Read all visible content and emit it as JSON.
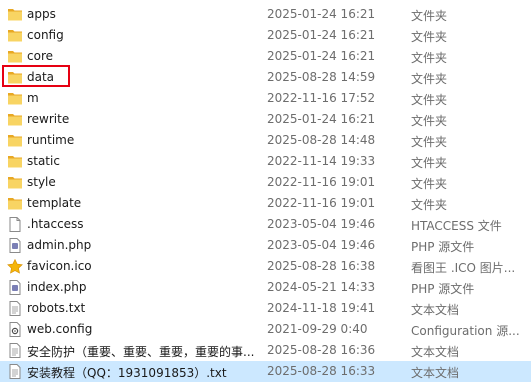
{
  "files": [
    {
      "name": "apps",
      "date": "2025-01-24 16:21",
      "type": "文件夹",
      "icon": "folder-icon"
    },
    {
      "name": "config",
      "date": "2025-01-24 16:21",
      "type": "文件夹",
      "icon": "folder-icon"
    },
    {
      "name": "core",
      "date": "2025-01-24 16:21",
      "type": "文件夹",
      "icon": "folder-icon"
    },
    {
      "name": "data",
      "date": "2025-08-28 14:59",
      "type": "文件夹",
      "icon": "folder-icon"
    },
    {
      "name": "m",
      "date": "2022-11-16 17:52",
      "type": "文件夹",
      "icon": "folder-icon"
    },
    {
      "name": "rewrite",
      "date": "2025-01-24 16:21",
      "type": "文件夹",
      "icon": "folder-icon"
    },
    {
      "name": "runtime",
      "date": "2025-08-28 14:48",
      "type": "文件夹",
      "icon": "folder-icon"
    },
    {
      "name": "static",
      "date": "2022-11-14 19:33",
      "type": "文件夹",
      "icon": "folder-icon"
    },
    {
      "name": "style",
      "date": "2022-11-16 19:01",
      "type": "文件夹",
      "icon": "folder-icon"
    },
    {
      "name": "template",
      "date": "2022-11-16 19:01",
      "type": "文件夹",
      "icon": "folder-icon"
    },
    {
      "name": ".htaccess",
      "date": "2023-05-04 19:46",
      "type": "HTACCESS 文件",
      "icon": "file-icon"
    },
    {
      "name": "admin.php",
      "date": "2023-05-04 19:46",
      "type": "PHP 源文件",
      "icon": "php-file-icon"
    },
    {
      "name": "favicon.ico",
      "date": "2025-08-28 16:38",
      "type": "看图王 .ICO 图片...",
      "icon": "star-icon"
    },
    {
      "name": "index.php",
      "date": "2024-05-21 14:33",
      "type": "PHP 源文件",
      "icon": "php-file-icon"
    },
    {
      "name": "robots.txt",
      "date": "2024-11-18 19:41",
      "type": "文本文档",
      "icon": "text-file-icon"
    },
    {
      "name": "web.config",
      "date": "2021-09-29 0:40",
      "type": "Configuration 源...",
      "icon": "config-file-icon"
    },
    {
      "name": "安全防护（重要、重要、重要，重要的事...",
      "date": "2025-08-28 16:36",
      "type": "文本文档",
      "icon": "text-file-icon"
    },
    {
      "name": "安装教程（QQ：1931091853）.txt",
      "date": "2025-08-28 16:33",
      "type": "文本文档",
      "icon": "text-file-icon"
    }
  ],
  "selected_index": 17,
  "highlighted_index": 3,
  "colors": {
    "selected_bg": "#cce8ff",
    "highlight_border": "#e60012",
    "folder": "#f5c33b"
  }
}
